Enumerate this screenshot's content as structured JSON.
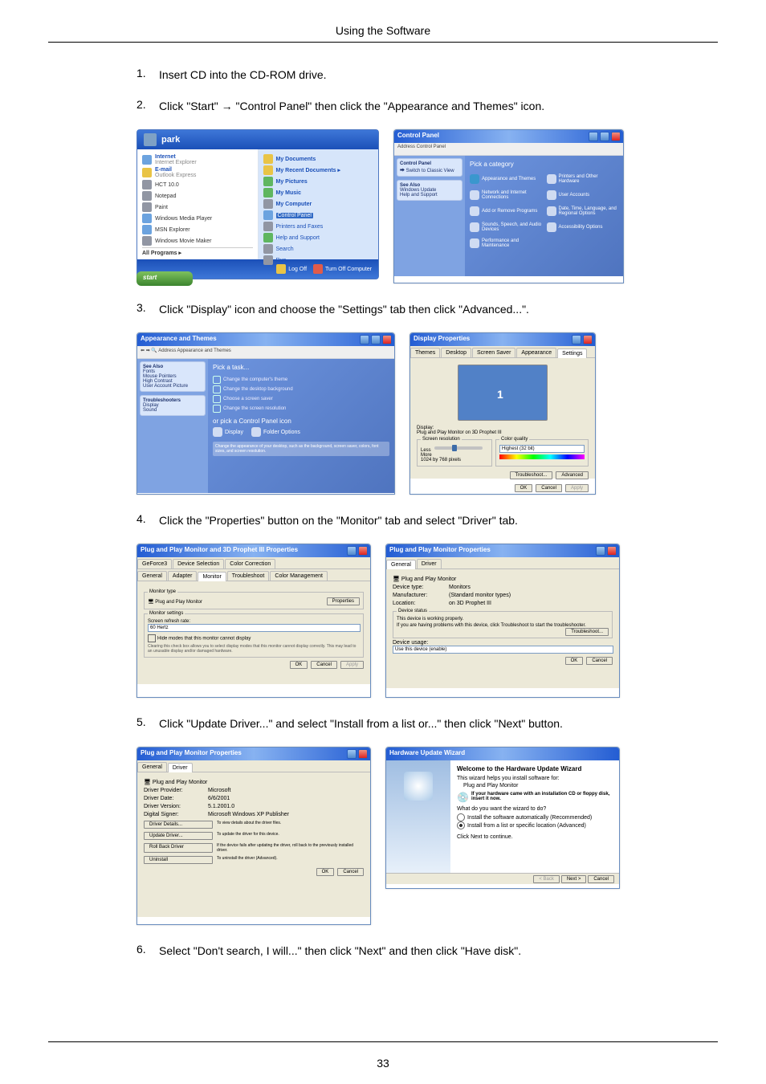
{
  "header": {
    "title": "Using the Software"
  },
  "steps": [
    {
      "num": "1.",
      "text": "Insert CD into the CD-ROM drive."
    },
    {
      "num": "2.",
      "text": "Click \"Start\" → \"Control Panel\" then click the \"Appearance and Themes\" icon."
    },
    {
      "num": "3.",
      "text": "Click \"Display\" icon and choose the \"Settings\" tab then click \"Advanced...\"."
    },
    {
      "num": "4.",
      "text": "Click the \"Properties\" button on the \"Monitor\" tab and select \"Driver\" tab."
    },
    {
      "num": "5.",
      "text": "Click \"Update Driver...\" and select \"Install from a list or...\" then click \"Next\" button."
    },
    {
      "num": "6.",
      "text": "Select \"Don't search, I will...\" then click \"Next\" and then click \"Have disk\"."
    }
  ],
  "start_menu": {
    "user": "park",
    "left": [
      {
        "label": "Internet",
        "sub": "Internet Explorer",
        "bold": true
      },
      {
        "label": "E-mail",
        "sub": "Outlook Express",
        "bold": true
      },
      {
        "label": "HCT 10.0"
      },
      {
        "label": "Notepad"
      },
      {
        "label": "Paint"
      },
      {
        "label": "Windows Media Player"
      },
      {
        "label": "MSN Explorer"
      },
      {
        "label": "Windows Movie Maker"
      },
      {
        "label": "All Programs"
      }
    ],
    "right": [
      {
        "label": "My Documents"
      },
      {
        "label": "My Recent Documents"
      },
      {
        "label": "My Pictures"
      },
      {
        "label": "My Music"
      },
      {
        "label": "My Computer"
      },
      {
        "label": "Control Panel",
        "highlight": true
      },
      {
        "label": "Printers and Faxes"
      },
      {
        "label": "Help and Support"
      },
      {
        "label": "Search"
      },
      {
        "label": "Run..."
      }
    ],
    "logoff": "Log Off",
    "shutdown": "Turn Off Computer",
    "start_btn": "start"
  },
  "cp_window": {
    "title": "Control Panel",
    "addr": "Address  Control Panel",
    "side_title": "Control Panel",
    "side_link": "Switch to Classic View",
    "see_also": "See Also",
    "see_links": [
      "Windows Update",
      "Help and Support"
    ],
    "cat_heading": "Pick a category",
    "items": [
      "Appearance and Themes",
      "Printers and Other Hardware",
      "Network and Internet Connections",
      "User Accounts",
      "Add or Remove Programs",
      "Date, Time, Language, and Regional Options",
      "Sounds, Speech, and Audio Devices",
      "Accessibility Options",
      "Performance and Maintenance"
    ]
  },
  "appearance_win": {
    "title": "Appearance and Themes",
    "task_heading": "Pick a task...",
    "tasks": [
      "Change the computer's theme",
      "Change the desktop background",
      "Choose a screen saver",
      "Change the screen resolution"
    ],
    "cp_icon_heading": "or pick a Control Panel icon",
    "icons": [
      "Display",
      "Folder Options"
    ],
    "footer": "Change the appearance of your desktop, such as the background, screen saver, colors, font sizes, and screen resolution."
  },
  "display_props": {
    "title": "Display Properties",
    "tabs": [
      "Themes",
      "Desktop",
      "Screen Saver",
      "Appearance",
      "Settings"
    ],
    "active_tab": "Settings",
    "display_label": "Display:",
    "display_value": "Plug and Play Monitor on 3D Prophet III",
    "res_label": "Screen resolution",
    "res_less": "Less",
    "res_more": "More",
    "res_value": "1024 by 768 pixels",
    "quality_label": "Color quality",
    "quality_value": "Highest (32 bit)",
    "troubleshoot_btn": "Troubleshoot...",
    "advanced_btn": "Advanced",
    "ok_btn": "OK",
    "cancel_btn": "Cancel",
    "apply_btn": "Apply"
  },
  "monitor_props": {
    "title": "Plug and Play Monitor and 3D Prophet III Properties",
    "tabs_top": [
      "GeForce3",
      "Device Selection",
      "Color Correction"
    ],
    "tabs_bottom": [
      "General",
      "Adapter",
      "Monitor",
      "Troubleshoot",
      "Color Management"
    ],
    "active_tab": "Monitor",
    "monitor_type": "Monitor type",
    "monitor_name": "Plug and Play Monitor",
    "properties_btn": "Properties",
    "monitor_settings": "Monitor settings",
    "refresh_label": "Screen refresh rate:",
    "refresh_value": "60 Hertz",
    "hide_modes_label": "Hide modes that this monitor cannot display",
    "hide_note": "Clearing this check box allows you to select display modes that this monitor cannot display correctly. This may lead to an unusable display and/or damaged hardware.",
    "ok_btn": "OK",
    "cancel_btn": "Cancel",
    "apply_btn": "Apply"
  },
  "monitor_general": {
    "title": "Plug and Play Monitor Properties",
    "tabs": [
      "General",
      "Driver"
    ],
    "active_tab": "General",
    "device_name": "Plug and Play Monitor",
    "device_type_l": "Device type:",
    "device_type_v": "Monitors",
    "manufacturer_l": "Manufacturer:",
    "manufacturer_v": "(Standard monitor types)",
    "location_l": "Location:",
    "location_v": "on 3D Prophet III",
    "status_group": "Device status",
    "status_text": "This device is working properly.",
    "status_note": "If you are having problems with this device, click Troubleshoot to start the troubleshooter.",
    "troubleshoot_btn": "Troubleshoot...",
    "usage_l": "Device usage:",
    "usage_v": "Use this device (enable)",
    "ok_btn": "OK",
    "cancel_btn": "Cancel"
  },
  "monitor_driver": {
    "title": "Plug and Play Monitor Properties",
    "tabs": [
      "General",
      "Driver"
    ],
    "active_tab": "Driver",
    "device_name": "Plug and Play Monitor",
    "provider_l": "Driver Provider:",
    "provider_v": "Microsoft",
    "date_l": "Driver Date:",
    "date_v": "6/6/2001",
    "version_l": "Driver Version:",
    "version_v": "5.1.2001.0",
    "signer_l": "Digital Signer:",
    "signer_v": "Microsoft Windows XP Publisher",
    "details_btn": "Driver Details...",
    "details_note": "To view details about the driver files.",
    "update_btn": "Update Driver...",
    "update_note": "To update the driver for this device.",
    "rollback_btn": "Roll Back Driver",
    "rollback_note": "If the device fails after updating the driver, roll back to the previously installed driver.",
    "uninstall_btn": "Uninstall",
    "uninstall_note": "To uninstall the driver (Advanced).",
    "ok_btn": "OK",
    "cancel_btn": "Cancel"
  },
  "wizard": {
    "title": "Hardware Update Wizard",
    "heading": "Welcome to the Hardware Update Wizard",
    "intro": "This wizard helps you install software for:",
    "device": "Plug and Play Monitor",
    "cd_note": "If your hardware came with an installation CD or floppy disk, insert it now.",
    "question": "What do you want the wizard to do?",
    "opt1": "Install the software automatically (Recommended)",
    "opt2": "Install from a list or specific location (Advanced)",
    "continue_note": "Click Next to continue.",
    "back_btn": "< Back",
    "next_btn": "Next >",
    "cancel_btn": "Cancel"
  },
  "page_number": "33"
}
